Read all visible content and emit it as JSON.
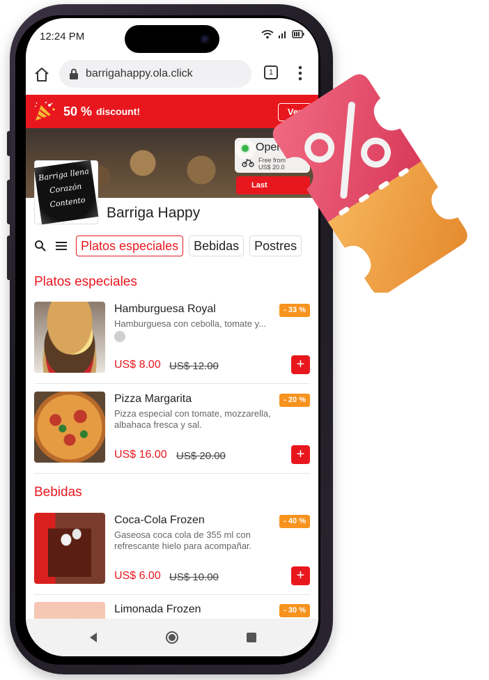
{
  "status_bar": {
    "time": "12:24 PM"
  },
  "browser": {
    "url": "barrigahappy.ola.click",
    "tab_count": "1"
  },
  "promo": {
    "percent": "50 %",
    "discount": "discount!",
    "button": "Ver"
  },
  "store": {
    "open_status": "Open",
    "info_icon": "i",
    "free_text_1": "Free from",
    "free_text_2": "US$ 20.0",
    "last_button": "Last",
    "logo_lines": [
      "Barriga llena",
      "Corazón",
      "Contento"
    ],
    "name": "Barriga Happy"
  },
  "categories": [
    "Platos especiales",
    "Bebidas",
    "Postres"
  ],
  "sections": [
    {
      "title": "Platos especiales",
      "products": [
        {
          "name": "Hamburguesa Royal",
          "desc": "Hamburguesa con cebolla, tomate y...",
          "badge": "- 33 %",
          "price": "US$ 8.00",
          "old_price": "US$ 12.00"
        },
        {
          "name": "Pizza Margarita",
          "desc": "Pizza especial con tomate, mozzarella, albahaca fresca y sal.",
          "badge": "- 20 %",
          "price": "US$ 16.00",
          "old_price": "US$ 20.00"
        }
      ]
    },
    {
      "title": "Bebidas",
      "products": [
        {
          "name": "Coca-Cola Frozen",
          "desc": "Gaseosa coca cola de 355 ml con refrescante hielo para acompañar.",
          "badge": "- 40 %",
          "price": "US$ 6.00",
          "old_price": "US$ 10.00"
        },
        {
          "name": "Limonada Frozen",
          "badge": "- 30 %"
        }
      ]
    }
  ],
  "add_label": "+",
  "colors": {
    "brand_red": "#e8171e",
    "badge_orange": "#f7931e",
    "coupon_pink": "#e24a68",
    "coupon_orange": "#f2a145"
  },
  "icons": [
    "home-icon",
    "lock-icon",
    "tabs-icon",
    "more-vert-icon",
    "party-popper-icon",
    "search-icon",
    "hamburger-menu-icon",
    "back-icon",
    "home-circle-icon",
    "recents-icon",
    "discount-coupon-icon"
  ]
}
